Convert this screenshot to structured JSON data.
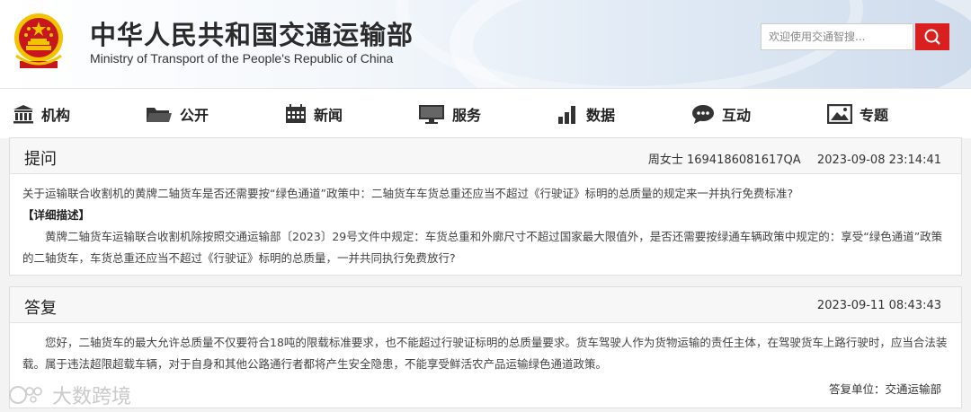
{
  "header": {
    "title_cn": "中华人民共和国交通运输部",
    "title_en": "Ministry of Transport of the People's Republic of China",
    "search_placeholder": "欢迎使用交通智搜...",
    "search_icon": "magnifier-icon"
  },
  "nav": {
    "items": [
      {
        "label": "机构",
        "icon": "building-icon"
      },
      {
        "label": "公开",
        "icon": "folder-icon"
      },
      {
        "label": "新闻",
        "icon": "calendar-icon"
      },
      {
        "label": "服务",
        "icon": "monitor-icon"
      },
      {
        "label": "数据",
        "icon": "bar-chart-icon"
      },
      {
        "label": "互动",
        "icon": "chat-icon"
      },
      {
        "label": "专题",
        "icon": "image-icon"
      }
    ]
  },
  "question": {
    "heading": "提问",
    "asker": "周女士 1694186081617QA",
    "time": "2023-09-08 23:14:41",
    "summary": "关于运输联合收割机的黄牌二轴货车是否还需要按“绿色通道”政策中：二轴货车车货总重还应当不超过《行驶证》标明的总质量的规定来一并执行免费标准?",
    "detail_label": "【详细描述】",
    "detail": "黄牌二轴货车运输联合收割机除按照交通运输部〔2023〕29号文件中规定：车货总重和外廓尺寸不超过国家最大限值外，是否还需要按绿通车辆政策中规定的：享受“绿色通道”政策的二轴货车，车货总重还应当不超过《行驶证》标明的总质量，一并共同执行免费放行?"
  },
  "answer": {
    "heading": "答复",
    "time": "2023-09-11 08:43:43",
    "body": "您好，二轴货车的最大允许总质量不仅要符合18吨的限载标准要求，也不能超过行驶证标明的总质量要求。货车驾驶人作为货物运输的责任主体，在驾驶货车上路行驶时，应当合法装载。属于违法超限超载车辆，对于自身和其他公路通行者都将产生安全隐患，不能享受鲜活农产品运输绿色通道政策。",
    "unit": "答复单位：交通运输部"
  },
  "watermark": {
    "text": "大数跨境"
  },
  "colors": {
    "accent_red": "#d9201f",
    "emblem_red": "#c8161d",
    "emblem_gold": "#f2c300"
  }
}
